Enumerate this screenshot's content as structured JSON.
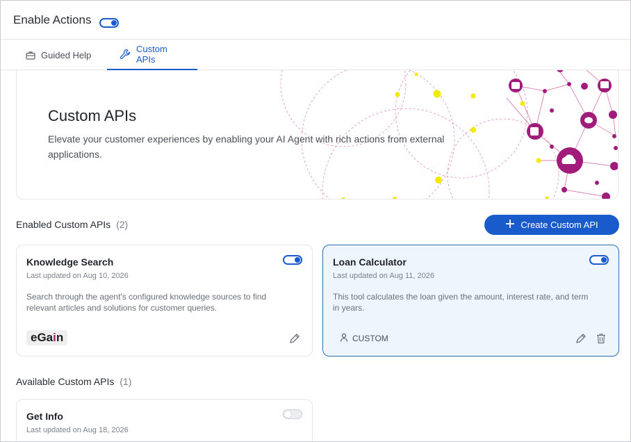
{
  "header": {
    "title": "Enable Actions",
    "enabled": true
  },
  "tabs": [
    {
      "label": "Guided Help",
      "icon": "briefcase-icon",
      "active": false
    },
    {
      "label": "Custom APIs",
      "icon": "wrench-icon",
      "active": true
    }
  ],
  "hero": {
    "title": "Custom APIs",
    "description": "Elevate your customer experiences by enabling your AI Agent with rich actions from external applications."
  },
  "enabled_section": {
    "title": "Enabled Custom APIs",
    "count": "(2)",
    "create_label": "Create Custom API"
  },
  "enabled_apis": [
    {
      "name": "Knowledge Search",
      "updated": "Last updated on Aug 10, 2026",
      "description": "Search through the agent's configured knowledge sources to find relevant articles and solutions for customer queries.",
      "enabled": true,
      "provider_logo": {
        "prefix": "eGa",
        "accent": "i",
        "suffix": "n"
      }
    },
    {
      "name": "Loan Calculator",
      "updated": "Last updated on Aug 11, 2026",
      "description": "This tool calculates the loan given the amount, interest rate, and term in years.",
      "enabled": true,
      "tag": "CUSTOM"
    }
  ],
  "available_section": {
    "title": "Available Custom APIs",
    "count": "(1)"
  },
  "available_apis": [
    {
      "name": "Get Info",
      "updated": "Last updated on Aug 18, 2026",
      "enabled": false
    }
  ],
  "colors": {
    "accent": "#1a5bcc",
    "brand_pink": "#a01b7a",
    "node_yellow": "#f2ea00",
    "selected_bg": "#eef5fc"
  }
}
